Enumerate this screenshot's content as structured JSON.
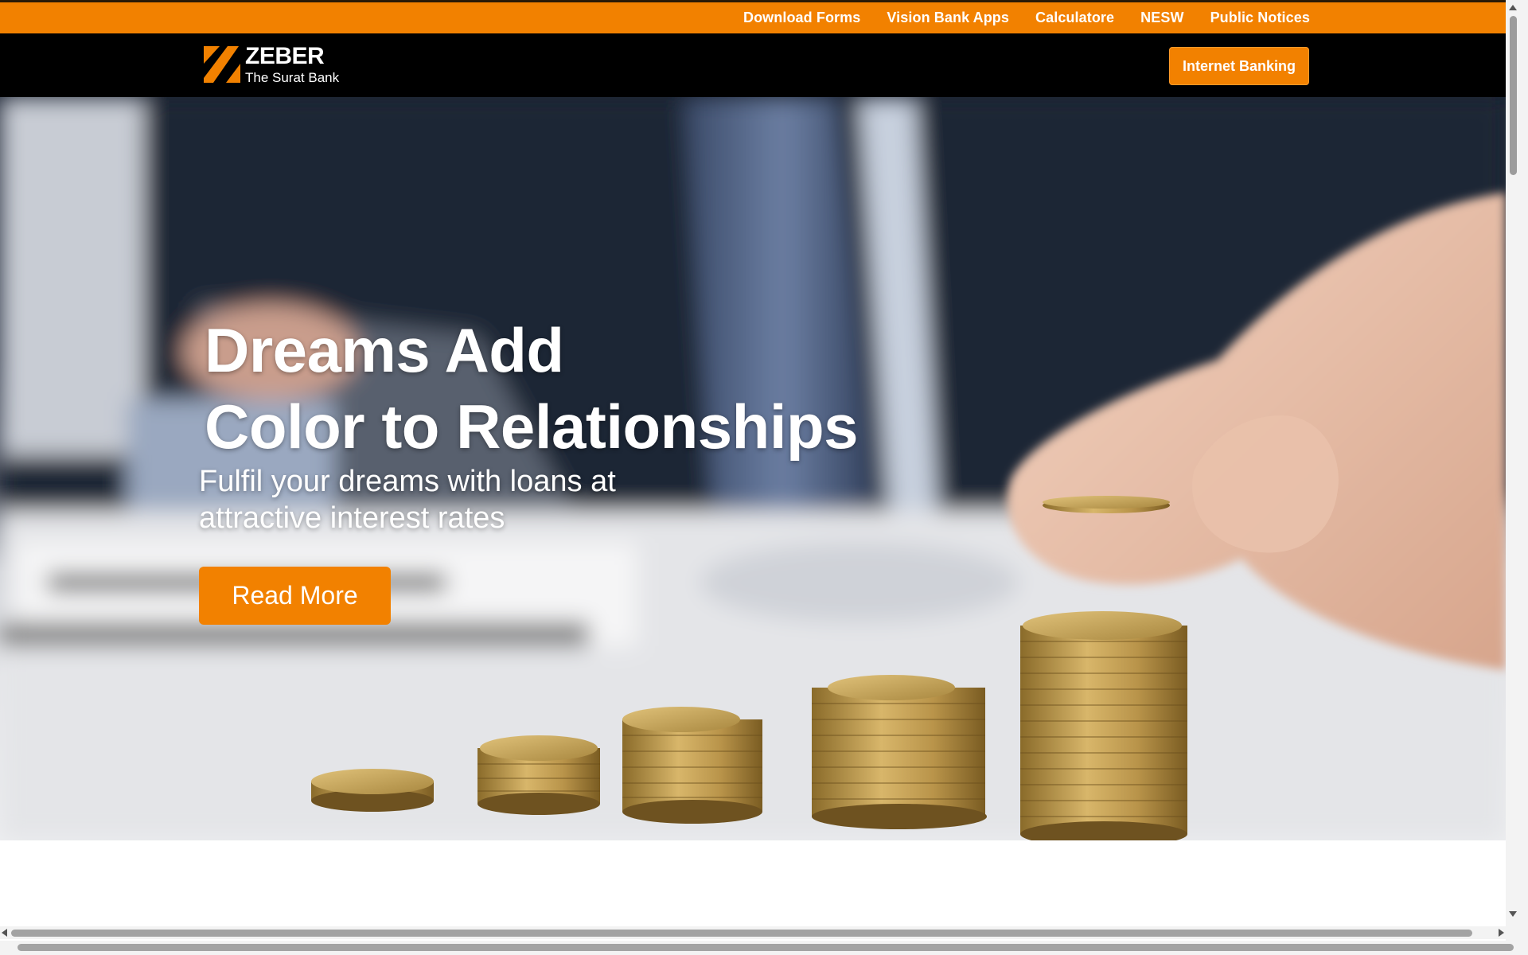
{
  "topbar": {
    "links": [
      "Download Forms",
      "Vision Bank Apps",
      "Calculatore",
      "NESW",
      "Public Notices"
    ]
  },
  "header": {
    "logo_name": "ZEBER",
    "logo_sub": "The Surat Bank",
    "internet_banking_label": "Internet Banking"
  },
  "hero": {
    "title_line1": "Dreams Add",
    "title_line2": "Color to Relationships",
    "subtitle_line1": "Fulfil your dreams with loans at",
    "subtitle_line2": "attractive interest rates",
    "read_more_label": "Read More"
  },
  "colors": {
    "accent": "#f28100",
    "header_bg": "#000000"
  }
}
